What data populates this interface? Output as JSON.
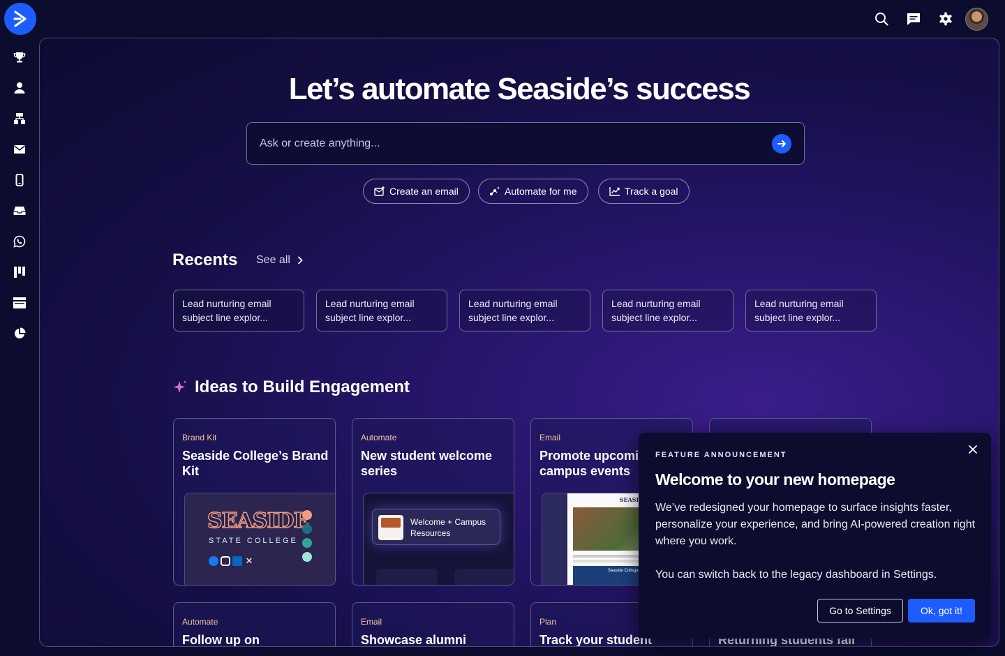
{
  "sidebar": {
    "icons": [
      "trophy-icon",
      "contacts-icon",
      "org-chart-icon",
      "email-icon",
      "mobile-icon",
      "inbox-icon",
      "whatsapp-icon",
      "kanban-icon",
      "layout-icon",
      "reports-pie-icon"
    ]
  },
  "topbar": {
    "icons": [
      "search-icon",
      "chat-icon",
      "settings-gear-icon"
    ]
  },
  "hero": {
    "title": "Let’s automate Seaside’s success",
    "search_placeholder": "Ask or create anything..."
  },
  "quick_actions": [
    {
      "label": "Create an email",
      "icon": "email-add-icon"
    },
    {
      "label": "Automate for me",
      "icon": "automation-sparkle-icon"
    },
    {
      "label": "Track a goal",
      "icon": "chart-trend-icon"
    }
  ],
  "recents": {
    "title": "Recents",
    "see_all": "See all",
    "items": [
      "Lead nurturing email subject line explor...",
      "Lead nurturing email subject line explor...",
      "Lead nurturing email subject line explor...",
      "Lead nurturing email subject line explor...",
      "Lead nurturing email subject line explor..."
    ]
  },
  "ideas": {
    "title": "Ideas to Build Engagement",
    "cards_row1": [
      {
        "category": "Brand Kit",
        "title": "Seaside College’s Brand Kit"
      },
      {
        "category": "Automate",
        "title": "New student welcome series"
      },
      {
        "category": "Email",
        "title": "Promote upcoming campus events"
      },
      {
        "category": "",
        "title": ""
      }
    ],
    "cards_row2": [
      {
        "category": "Automate",
        "title": "Follow up on"
      },
      {
        "category": "Email",
        "title": "Showcase alumni"
      },
      {
        "category": "Plan",
        "title": "Track your student"
      },
      {
        "category": "",
        "title": "Returning students fall"
      }
    ],
    "brand_preview": {
      "wordmark": "SEASIDE",
      "subtitle": "STATE COLLEGE",
      "swatches": [
        "#f39b7f",
        "#1d6f86",
        "#2fa59a",
        "#9fe3d5"
      ]
    },
    "welcome_preview": {
      "label": "Welcome + Campus Resources"
    },
    "email_preview": {
      "masthead": "SEASIDE",
      "caption": "Seaside College"
    }
  },
  "popup": {
    "eyebrow": "FEATURE ANNOUNCEMENT",
    "title": "Welcome to your new homepage",
    "body": "We’ve redesigned your homepage to surface insights faster, personalize your experience, and bring AI-powered creation right where you work.",
    "body2": "You can switch back to the legacy dashboard in Settings.",
    "secondary_button": "Go to Settings",
    "primary_button": "Ok, got it!"
  }
}
